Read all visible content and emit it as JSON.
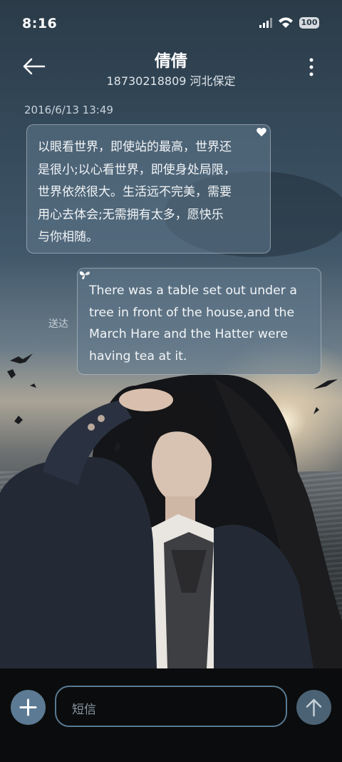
{
  "status_bar": {
    "time": "8:16",
    "battery": "100"
  },
  "header": {
    "back_icon": "arrow-left-icon",
    "contact_name": "倩倩",
    "contact_subtitle": "18730218809 河北保定",
    "more_icon": "more-vertical-icon"
  },
  "conversation": {
    "timestamp": "2016/6/13 13:49",
    "messages": [
      {
        "direction": "incoming",
        "lines": [
          "以眼看世界，即使站的最高，世界还",
          "是很小;以心看世界，即使身处局限，",
          "世界依然很大。生活远不完美，需要",
          "用心去体会;无需拥有太多，愿快乐",
          "与你相随。"
        ],
        "icon": "heart-icon"
      },
      {
        "direction": "outgoing",
        "lines": [
          "There was a table set out under a",
          "tree in front of the house,and the",
          "March Hare and the Hatter were",
          "having tea at it."
        ],
        "status": "送达",
        "icon": "butterfly-icon"
      }
    ]
  },
  "composer": {
    "placeholder": "短信",
    "add_icon": "plus-icon",
    "send_icon": "arrow-up-icon"
  },
  "colors": {
    "accent": "#5c7a93",
    "bubble": "#60788c",
    "bottom_bar": "#0b0c0d"
  }
}
